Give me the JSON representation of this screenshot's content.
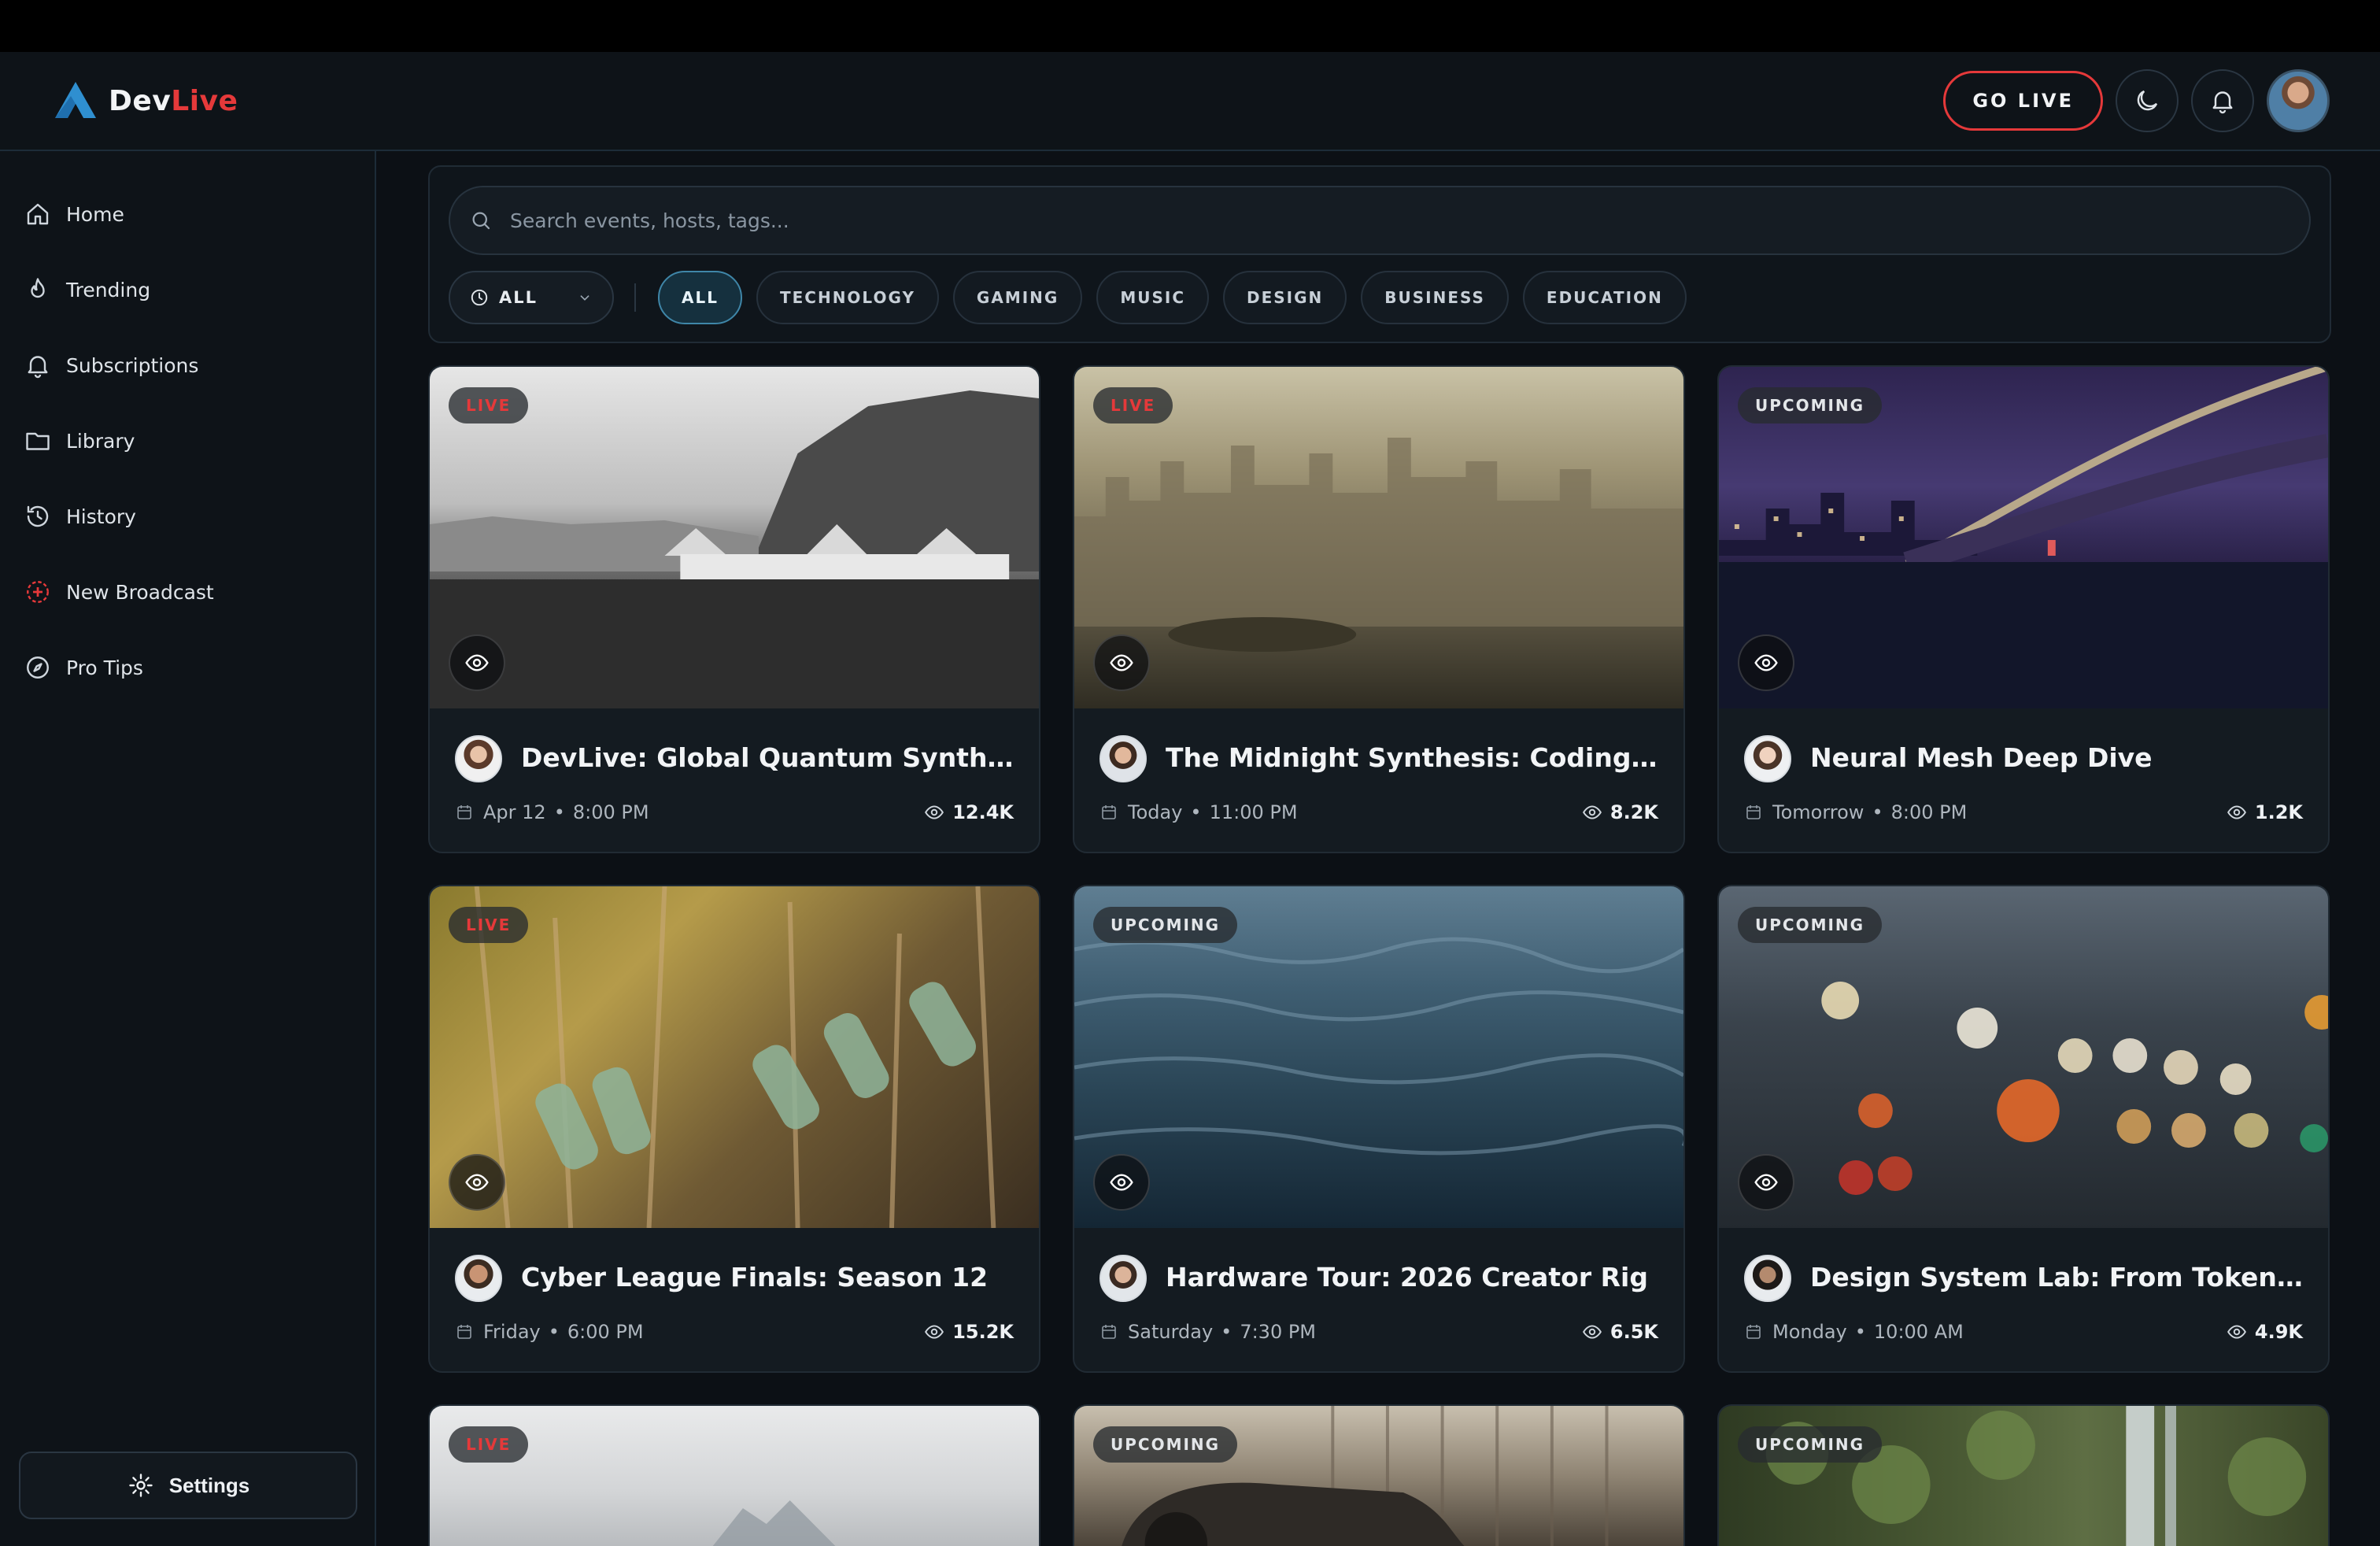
{
  "app": {
    "logo_main": "Dev",
    "logo_accent": "Live"
  },
  "header": {
    "go_live_label": "GO LIVE",
    "theme_icon": "moon-icon",
    "notifications_icon": "bell-icon"
  },
  "sidebar": {
    "items": [
      {
        "label": "Home",
        "icon": "home-icon"
      },
      {
        "label": "Trending",
        "icon": "flame-icon"
      },
      {
        "label": "Subscriptions",
        "icon": "bell-icon"
      },
      {
        "label": "Library",
        "icon": "folder-icon"
      },
      {
        "label": "History",
        "icon": "history-icon"
      },
      {
        "label": "New Broadcast",
        "icon": "plus-circle-icon"
      },
      {
        "label": "Pro Tips",
        "icon": "compass-icon"
      }
    ],
    "settings_label": "Settings"
  },
  "search": {
    "placeholder": "Search events, hosts, tags..."
  },
  "filters": {
    "time_selected": "ALL",
    "categories": [
      "ALL",
      "TECHNOLOGY",
      "GAMING",
      "MUSIC",
      "DESIGN",
      "BUSINESS",
      "EDUCATION"
    ],
    "active_category": "ALL"
  },
  "colors": {
    "accent_red": "#e5393a",
    "accent_blue": "#2f8fd0",
    "background": "#0c1015"
  },
  "cards": [
    {
      "badge": "LIVE",
      "title": "DevLive: Global Quantum Synthesis",
      "date": "Apr 12",
      "time": "8:00 PM",
      "views": "12.4K"
    },
    {
      "badge": "LIVE",
      "title": "The Midnight Synthesis: Coding and...",
      "date": "Today",
      "time": "11:00 PM",
      "views": "8.2K"
    },
    {
      "badge": "UPCOMING",
      "title": "Neural Mesh Deep Dive",
      "date": "Tomorrow",
      "time": "8:00 PM",
      "views": "1.2K"
    },
    {
      "badge": "LIVE",
      "title": "Cyber League Finals: Season 12",
      "date": "Friday",
      "time": "6:00 PM",
      "views": "15.2K"
    },
    {
      "badge": "UPCOMING",
      "title": "Hardware Tour: 2026 Creator Rig",
      "date": "Saturday",
      "time": "7:30 PM",
      "views": "6.5K"
    },
    {
      "badge": "UPCOMING",
      "title": "Design System Lab: From Tokens to...",
      "date": "Monday",
      "time": "10:00 AM",
      "views": "4.9K"
    },
    {
      "badge": "LIVE"
    },
    {
      "badge": "UPCOMING"
    },
    {
      "badge": "UPCOMING"
    }
  ]
}
